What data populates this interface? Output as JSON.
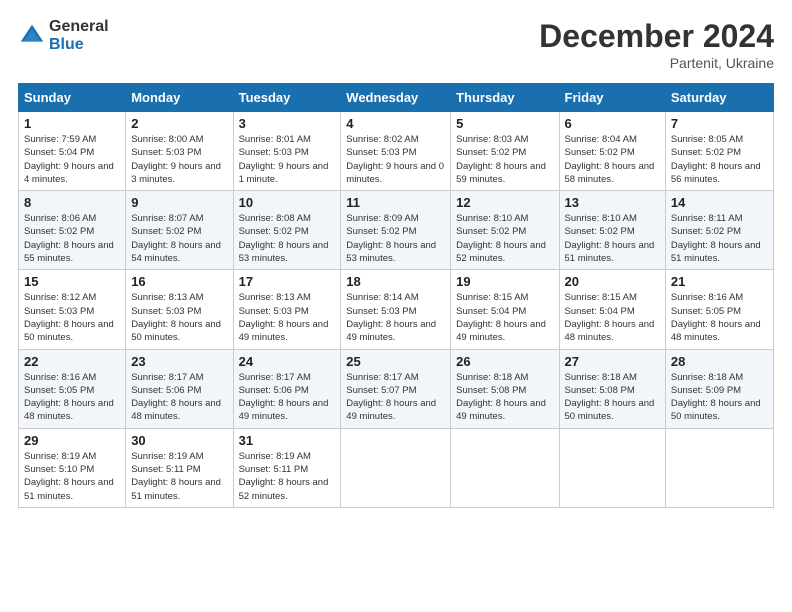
{
  "logo": {
    "text_general": "General",
    "text_blue": "Blue"
  },
  "header": {
    "month_year": "December 2024",
    "location": "Partenit, Ukraine"
  },
  "weekdays": [
    "Sunday",
    "Monday",
    "Tuesday",
    "Wednesday",
    "Thursday",
    "Friday",
    "Saturday"
  ],
  "weeks": [
    [
      {
        "day": "1",
        "sunrise": "Sunrise: 7:59 AM",
        "sunset": "Sunset: 5:04 PM",
        "daylight": "Daylight: 9 hours and 4 minutes."
      },
      {
        "day": "2",
        "sunrise": "Sunrise: 8:00 AM",
        "sunset": "Sunset: 5:03 PM",
        "daylight": "Daylight: 9 hours and 3 minutes."
      },
      {
        "day": "3",
        "sunrise": "Sunrise: 8:01 AM",
        "sunset": "Sunset: 5:03 PM",
        "daylight": "Daylight: 9 hours and 1 minute."
      },
      {
        "day": "4",
        "sunrise": "Sunrise: 8:02 AM",
        "sunset": "Sunset: 5:03 PM",
        "daylight": "Daylight: 9 hours and 0 minutes."
      },
      {
        "day": "5",
        "sunrise": "Sunrise: 8:03 AM",
        "sunset": "Sunset: 5:02 PM",
        "daylight": "Daylight: 8 hours and 59 minutes."
      },
      {
        "day": "6",
        "sunrise": "Sunrise: 8:04 AM",
        "sunset": "Sunset: 5:02 PM",
        "daylight": "Daylight: 8 hours and 58 minutes."
      },
      {
        "day": "7",
        "sunrise": "Sunrise: 8:05 AM",
        "sunset": "Sunset: 5:02 PM",
        "daylight": "Daylight: 8 hours and 56 minutes."
      }
    ],
    [
      {
        "day": "8",
        "sunrise": "Sunrise: 8:06 AM",
        "sunset": "Sunset: 5:02 PM",
        "daylight": "Daylight: 8 hours and 55 minutes."
      },
      {
        "day": "9",
        "sunrise": "Sunrise: 8:07 AM",
        "sunset": "Sunset: 5:02 PM",
        "daylight": "Daylight: 8 hours and 54 minutes."
      },
      {
        "day": "10",
        "sunrise": "Sunrise: 8:08 AM",
        "sunset": "Sunset: 5:02 PM",
        "daylight": "Daylight: 8 hours and 53 minutes."
      },
      {
        "day": "11",
        "sunrise": "Sunrise: 8:09 AM",
        "sunset": "Sunset: 5:02 PM",
        "daylight": "Daylight: 8 hours and 53 minutes."
      },
      {
        "day": "12",
        "sunrise": "Sunrise: 8:10 AM",
        "sunset": "Sunset: 5:02 PM",
        "daylight": "Daylight: 8 hours and 52 minutes."
      },
      {
        "day": "13",
        "sunrise": "Sunrise: 8:10 AM",
        "sunset": "Sunset: 5:02 PM",
        "daylight": "Daylight: 8 hours and 51 minutes."
      },
      {
        "day": "14",
        "sunrise": "Sunrise: 8:11 AM",
        "sunset": "Sunset: 5:02 PM",
        "daylight": "Daylight: 8 hours and 51 minutes."
      }
    ],
    [
      {
        "day": "15",
        "sunrise": "Sunrise: 8:12 AM",
        "sunset": "Sunset: 5:03 PM",
        "daylight": "Daylight: 8 hours and 50 minutes."
      },
      {
        "day": "16",
        "sunrise": "Sunrise: 8:13 AM",
        "sunset": "Sunset: 5:03 PM",
        "daylight": "Daylight: 8 hours and 50 minutes."
      },
      {
        "day": "17",
        "sunrise": "Sunrise: 8:13 AM",
        "sunset": "Sunset: 5:03 PM",
        "daylight": "Daylight: 8 hours and 49 minutes."
      },
      {
        "day": "18",
        "sunrise": "Sunrise: 8:14 AM",
        "sunset": "Sunset: 5:03 PM",
        "daylight": "Daylight: 8 hours and 49 minutes."
      },
      {
        "day": "19",
        "sunrise": "Sunrise: 8:15 AM",
        "sunset": "Sunset: 5:04 PM",
        "daylight": "Daylight: 8 hours and 49 minutes."
      },
      {
        "day": "20",
        "sunrise": "Sunrise: 8:15 AM",
        "sunset": "Sunset: 5:04 PM",
        "daylight": "Daylight: 8 hours and 48 minutes."
      },
      {
        "day": "21",
        "sunrise": "Sunrise: 8:16 AM",
        "sunset": "Sunset: 5:05 PM",
        "daylight": "Daylight: 8 hours and 48 minutes."
      }
    ],
    [
      {
        "day": "22",
        "sunrise": "Sunrise: 8:16 AM",
        "sunset": "Sunset: 5:05 PM",
        "daylight": "Daylight: 8 hours and 48 minutes."
      },
      {
        "day": "23",
        "sunrise": "Sunrise: 8:17 AM",
        "sunset": "Sunset: 5:06 PM",
        "daylight": "Daylight: 8 hours and 48 minutes."
      },
      {
        "day": "24",
        "sunrise": "Sunrise: 8:17 AM",
        "sunset": "Sunset: 5:06 PM",
        "daylight": "Daylight: 8 hours and 49 minutes."
      },
      {
        "day": "25",
        "sunrise": "Sunrise: 8:17 AM",
        "sunset": "Sunset: 5:07 PM",
        "daylight": "Daylight: 8 hours and 49 minutes."
      },
      {
        "day": "26",
        "sunrise": "Sunrise: 8:18 AM",
        "sunset": "Sunset: 5:08 PM",
        "daylight": "Daylight: 8 hours and 49 minutes."
      },
      {
        "day": "27",
        "sunrise": "Sunrise: 8:18 AM",
        "sunset": "Sunset: 5:08 PM",
        "daylight": "Daylight: 8 hours and 50 minutes."
      },
      {
        "day": "28",
        "sunrise": "Sunrise: 8:18 AM",
        "sunset": "Sunset: 5:09 PM",
        "daylight": "Daylight: 8 hours and 50 minutes."
      }
    ],
    [
      {
        "day": "29",
        "sunrise": "Sunrise: 8:19 AM",
        "sunset": "Sunset: 5:10 PM",
        "daylight": "Daylight: 8 hours and 51 minutes."
      },
      {
        "day": "30",
        "sunrise": "Sunrise: 8:19 AM",
        "sunset": "Sunset: 5:11 PM",
        "daylight": "Daylight: 8 hours and 51 minutes."
      },
      {
        "day": "31",
        "sunrise": "Sunrise: 8:19 AM",
        "sunset": "Sunset: 5:11 PM",
        "daylight": "Daylight: 8 hours and 52 minutes."
      },
      null,
      null,
      null,
      null
    ]
  ]
}
